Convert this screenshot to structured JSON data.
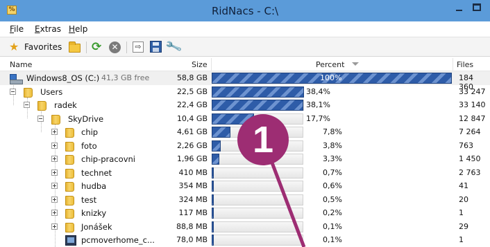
{
  "window": {
    "title": "RidNacs - C:\\",
    "app_icon": "%"
  },
  "menu": [
    {
      "accel": "F",
      "rest": "ile"
    },
    {
      "accel": "E",
      "rest": "xtras"
    },
    {
      "accel": "H",
      "rest": "elp"
    }
  ],
  "toolbar": {
    "favorites_label": "Favorites",
    "icons": [
      "favorites-star-icon",
      "open-folder-icon",
      "refresh-icon",
      "stop-icon",
      "export-icon",
      "save-icon",
      "options-wrench-icon"
    ]
  },
  "columns": {
    "name": "Name",
    "size": "Size",
    "percent": "Percent",
    "files": "Files"
  },
  "rows": [
    {
      "name": "Windows8_OS (C:)",
      "free": "41,3 GB free",
      "size": "58,8 GB",
      "percent": "100%",
      "fraction": 1.0,
      "files": "184 360",
      "icon": "drive-icon"
    },
    {
      "name": "Users",
      "size": "22,5 GB",
      "percent": "38,4%",
      "fraction": 0.384,
      "files": "33 247",
      "icon": "folder-icon"
    },
    {
      "name": "radek",
      "size": "22,4 GB",
      "percent": "38,1%",
      "fraction": 0.381,
      "files": "33 140",
      "icon": "folder-icon"
    },
    {
      "name": "SkyDrive",
      "size": "10,4 GB",
      "percent": "17,7%",
      "fraction": 0.177,
      "files": "12 847",
      "icon": "folder-icon"
    },
    {
      "name": "chip",
      "size": "4,61 GB",
      "percent": "7,8%",
      "fraction": 0.078,
      "files": "7 264",
      "icon": "folder-icon"
    },
    {
      "name": "foto",
      "size": "2,26 GB",
      "percent": "3,8%",
      "fraction": 0.038,
      "files": "763",
      "icon": "folder-icon"
    },
    {
      "name": "chip-pracovni",
      "size": "1,96 GB",
      "percent": "3,3%",
      "fraction": 0.033,
      "files": "1 450",
      "icon": "folder-icon"
    },
    {
      "name": "technet",
      "size": "410 MB",
      "percent": "0,7%",
      "fraction": 0.007,
      "files": "2 763",
      "icon": "folder-icon"
    },
    {
      "name": "hudba",
      "size": "354 MB",
      "percent": "0,6%",
      "fraction": 0.006,
      "files": "41",
      "icon": "folder-icon"
    },
    {
      "name": "test",
      "size": "324 MB",
      "percent": "0,5%",
      "fraction": 0.005,
      "files": "20",
      "icon": "folder-icon"
    },
    {
      "name": "knizky",
      "size": "117 MB",
      "percent": "0,2%",
      "fraction": 0.002,
      "files": "1",
      "icon": "folder-icon"
    },
    {
      "name": "Jonášek",
      "size": "88,8 MB",
      "percent": "0,1%",
      "fraction": 0.001,
      "files": "29",
      "icon": "folder-icon"
    },
    {
      "name": "pcmoverhome_c...",
      "size": "78,0 MB",
      "percent": "0,1%",
      "fraction": 0.001,
      "files": "1",
      "icon": "file-icon"
    }
  ],
  "annotation": {
    "number": "1",
    "color": "#9d2d73"
  },
  "colors": {
    "titlebar": "#5b9bd9",
    "bar_dark": "#2e5ca8",
    "bar_light": "#6d93d0"
  }
}
